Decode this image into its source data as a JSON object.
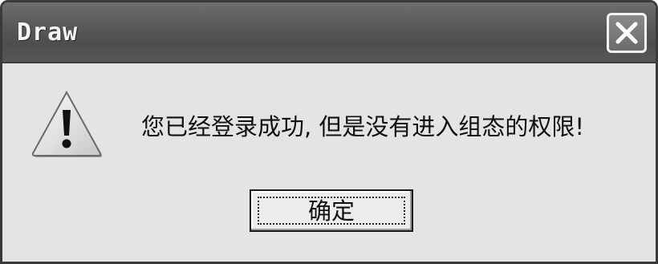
{
  "window": {
    "title": "Draw"
  },
  "dialog": {
    "icon": "warning-icon",
    "message": "您已经登录成功, 但是没有进入组态的权限!",
    "ok_label": "确定"
  }
}
